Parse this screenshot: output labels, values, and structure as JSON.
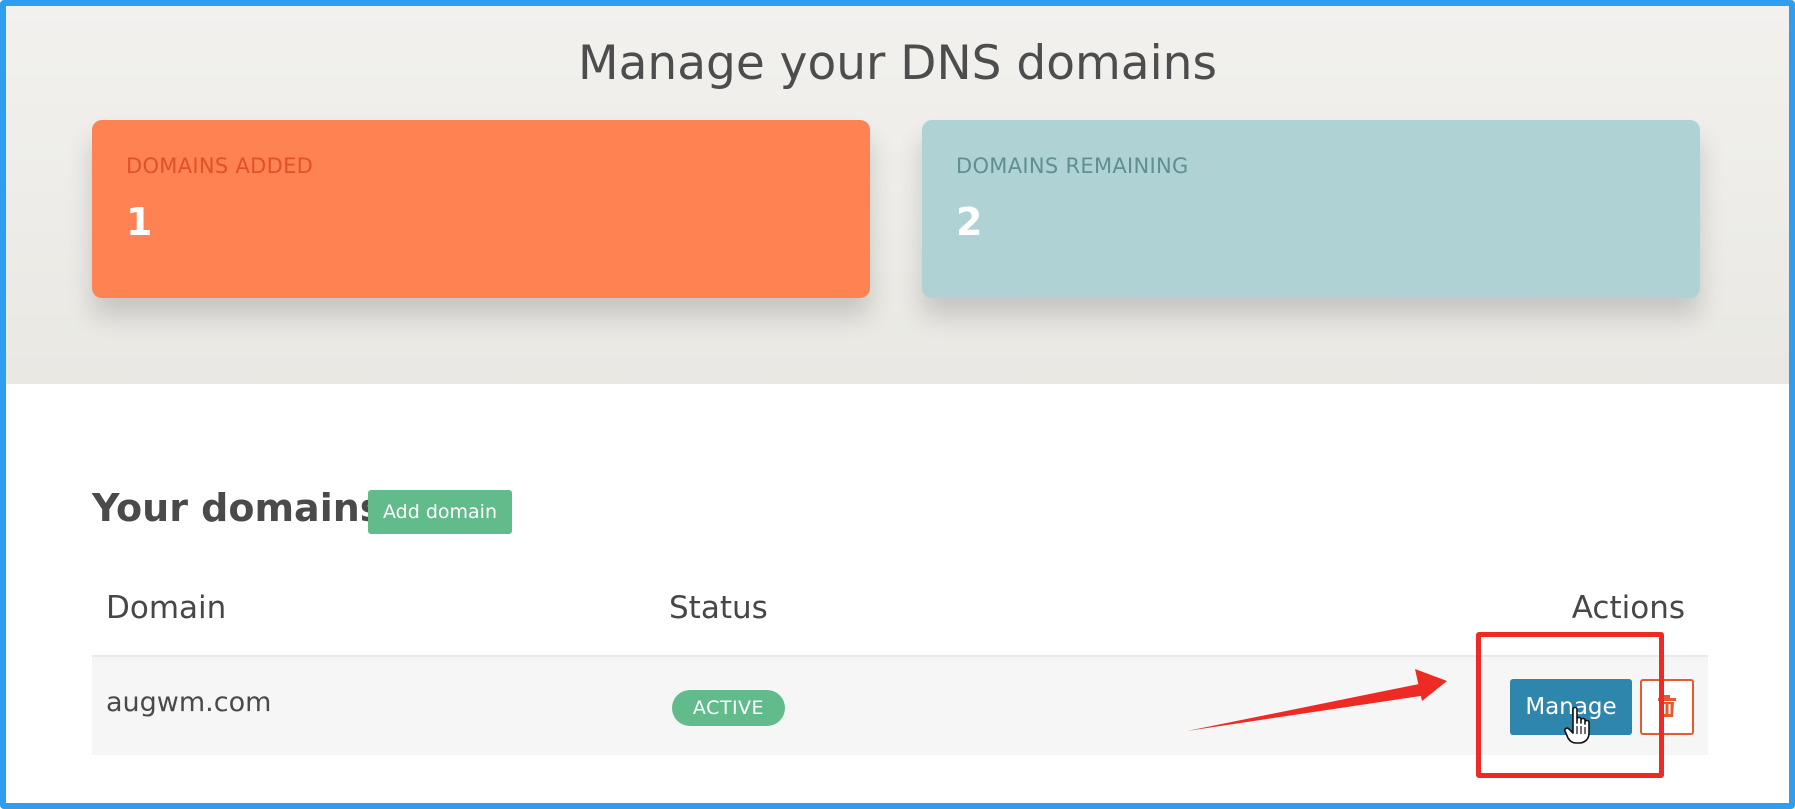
{
  "page": {
    "title": "Manage your DNS domains"
  },
  "stats": {
    "added": {
      "label": "DOMAINS ADDED",
      "value": "1",
      "color": "#ff8252"
    },
    "remaining": {
      "label": "DOMAINS REMAINING",
      "value": "2",
      "color": "#afd3d4"
    }
  },
  "domains_section": {
    "title": "Your domains",
    "add_button_label": "Add domain"
  },
  "table": {
    "headers": {
      "domain": "Domain",
      "status": "Status",
      "actions": "Actions"
    },
    "rows": [
      {
        "domain": "augwm.com",
        "status": "ACTIVE",
        "manage_label": "Manage",
        "delete_icon": "trash-icon"
      }
    ]
  },
  "colors": {
    "frame": "#2f9ef0",
    "success": "#62bb8b",
    "primary": "#2e86ad",
    "danger": "#e35b2f",
    "annotation": "#ee2a24"
  },
  "icons": {
    "cursor": "hand-pointer-icon",
    "arrow": "annotation-arrow-icon"
  }
}
